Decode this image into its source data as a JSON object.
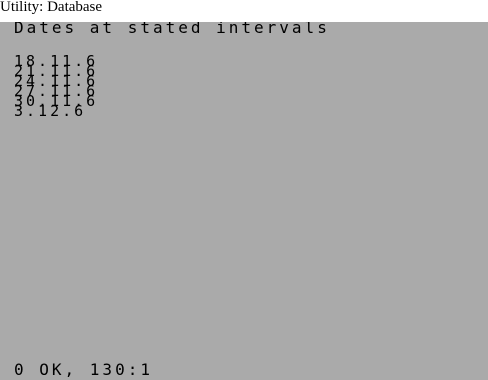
{
  "window": {
    "caption": "Utility: Database"
  },
  "screen": {
    "heading": "Dates at stated intervals",
    "dates": [
      "18.11.6",
      "21.11.6",
      "24.11.6",
      "27.11.6",
      "30.11.6",
      "3.12.6"
    ],
    "status": "0 OK, 130:1",
    "background_color": "#aaaaaa",
    "text_color": "#000000"
  }
}
